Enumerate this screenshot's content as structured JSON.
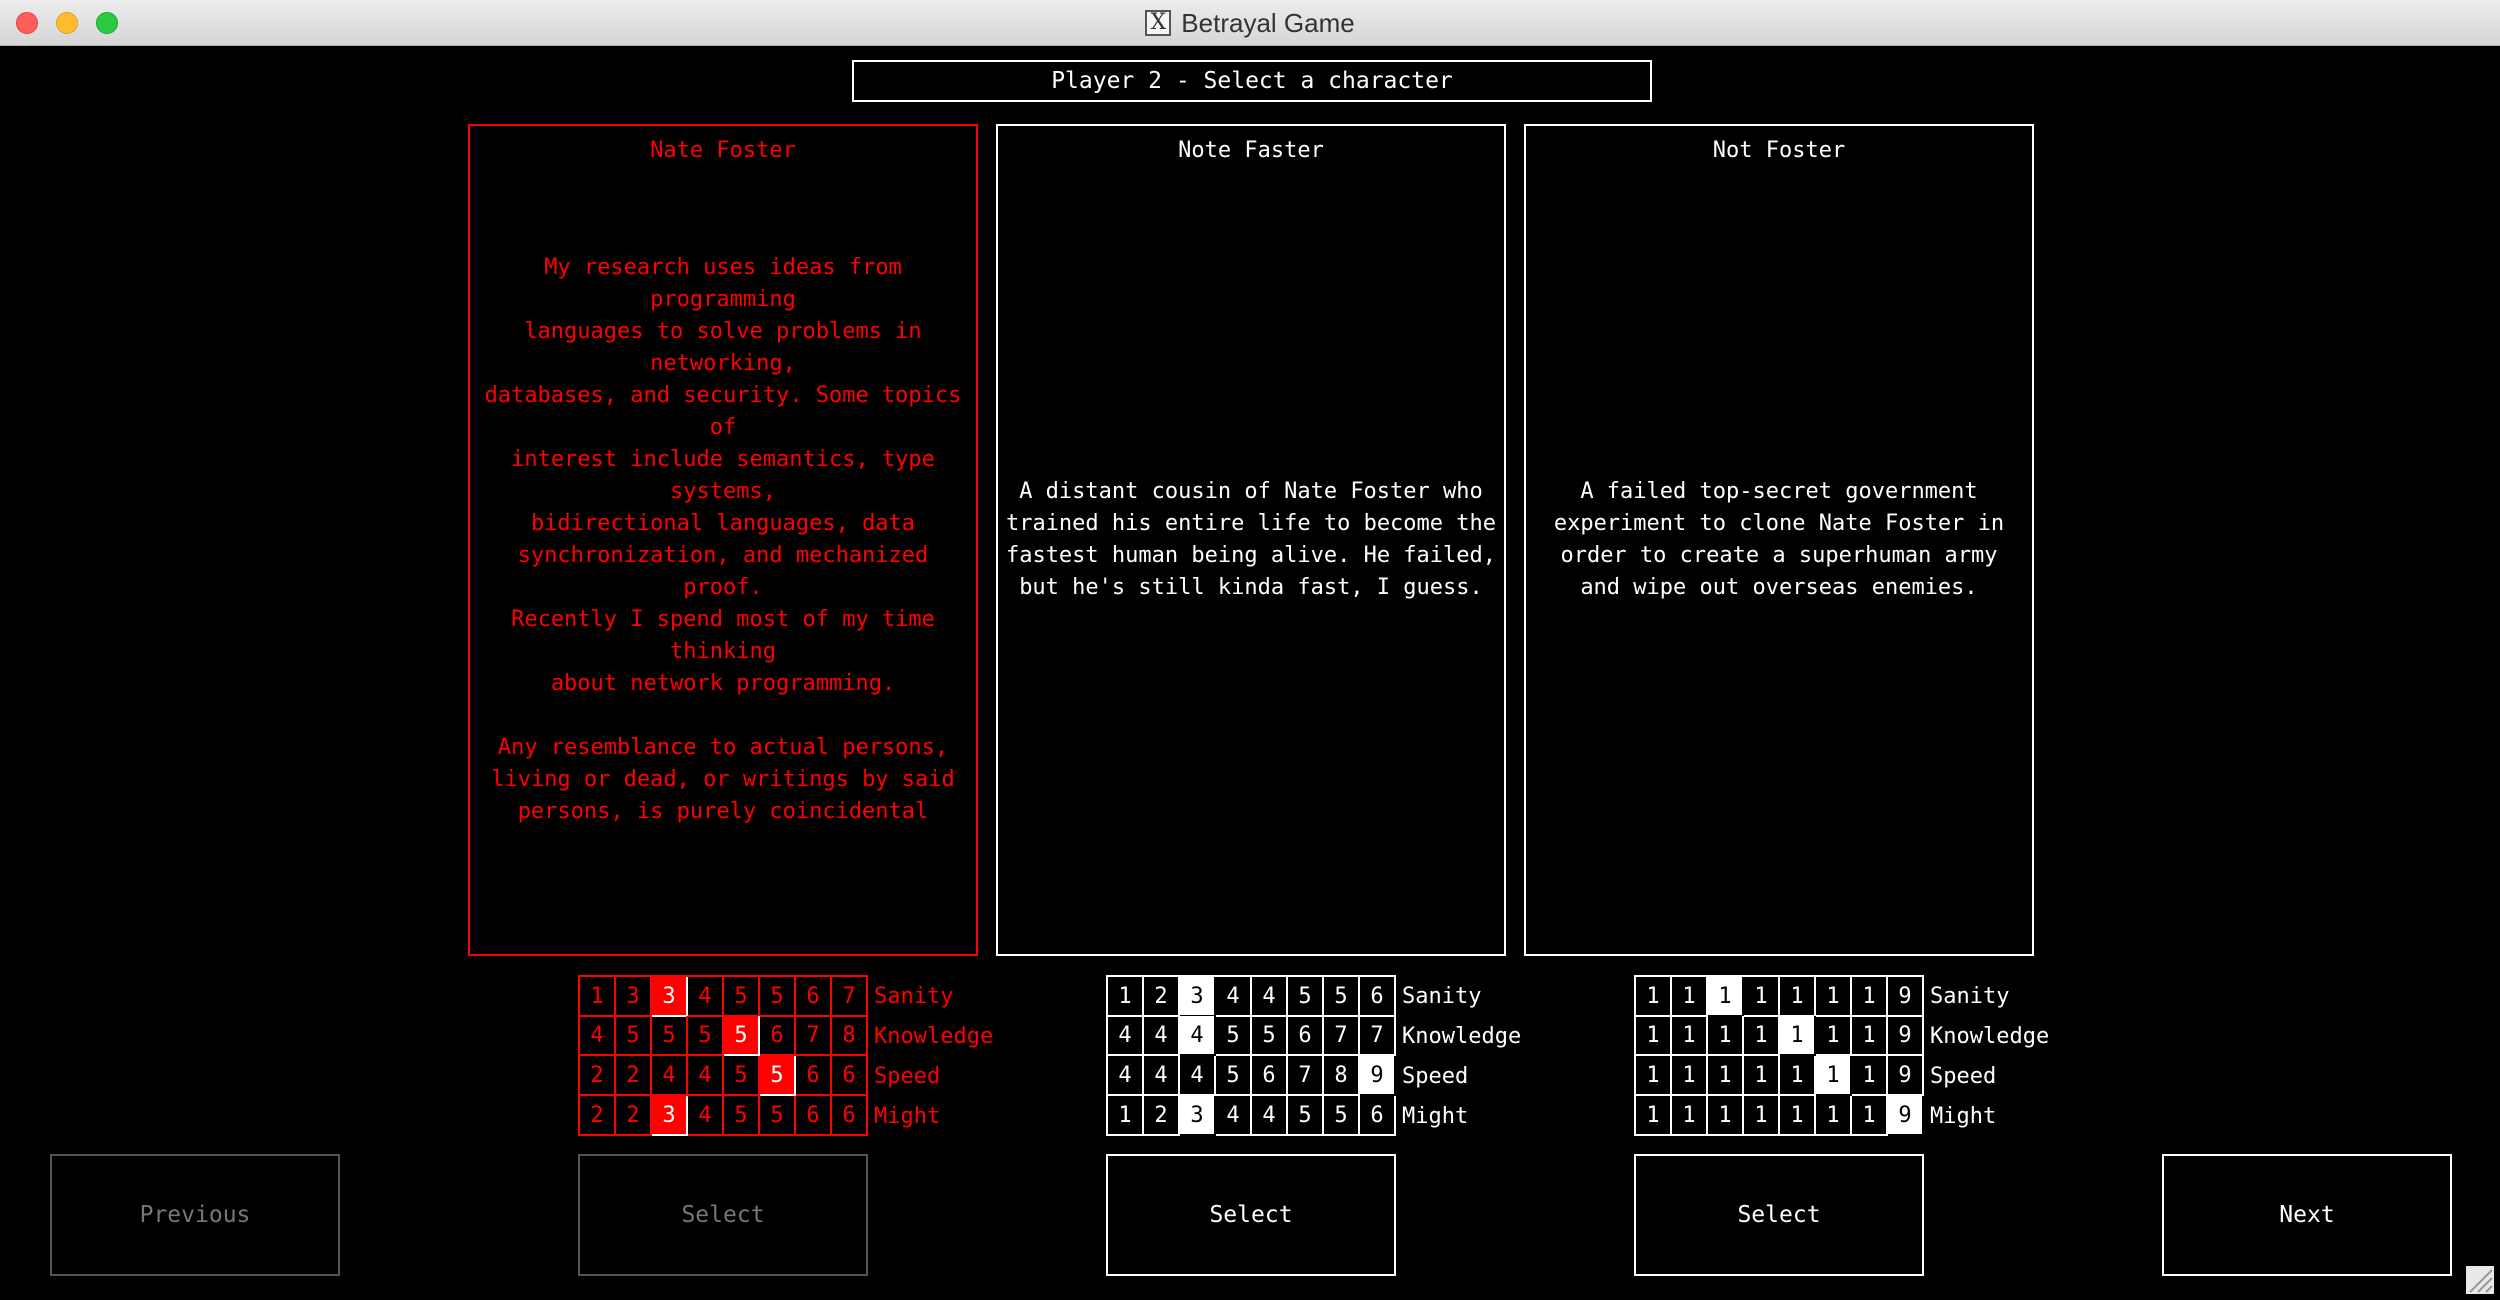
{
  "window": {
    "title": "Betrayal Game",
    "icon": "x11-icon"
  },
  "header": "Player 2 - Select a character",
  "characters": [
    {
      "name": "Nate Foster",
      "selected": true,
      "description": "My research uses ideas from programming\nlanguages to solve problems in networking,\ndatabases, and security. Some topics of\ninterest include semantics, type systems,\nbidirectional languages, data\nsynchronization, and mechanized proof.\nRecently I spend most of my time thinking\nabout network programming.\n\nAny resemblance to actual persons,\nliving or dead, or writings by said\npersons, is purely coincidental",
      "stats": [
        {
          "label": "Sanity",
          "values": [
            "1",
            "3",
            "3",
            "4",
            "5",
            "5",
            "6",
            "7"
          ],
          "current": 2
        },
        {
          "label": "Knowledge",
          "values": [
            "4",
            "5",
            "5",
            "5",
            "5",
            "6",
            "7",
            "8"
          ],
          "current": 4
        },
        {
          "label": "Speed",
          "values": [
            "2",
            "2",
            "4",
            "4",
            "5",
            "5",
            "6",
            "6"
          ],
          "current": 5
        },
        {
          "label": "Might",
          "values": [
            "2",
            "2",
            "3",
            "4",
            "5",
            "5",
            "6",
            "6"
          ],
          "current": 2
        }
      ],
      "select_label": "Select",
      "select_enabled": false
    },
    {
      "name": "Note Faster",
      "selected": false,
      "description": "A distant cousin of Nate Foster who\ntrained his entire life to become the\nfastest human being alive. He failed,\nbut he's still kinda fast, I guess.",
      "stats": [
        {
          "label": "Sanity",
          "values": [
            "1",
            "2",
            "3",
            "4",
            "4",
            "5",
            "5",
            "6"
          ],
          "current": 2
        },
        {
          "label": "Knowledge",
          "values": [
            "4",
            "4",
            "4",
            "5",
            "5",
            "6",
            "7",
            "7"
          ],
          "current": 2
        },
        {
          "label": "Speed",
          "values": [
            "4",
            "4",
            "4",
            "5",
            "6",
            "7",
            "8",
            "9"
          ],
          "current": 7
        },
        {
          "label": "Might",
          "values": [
            "1",
            "2",
            "3",
            "4",
            "4",
            "5",
            "5",
            "6"
          ],
          "current": 2
        }
      ],
      "select_label": "Select",
      "select_enabled": true
    },
    {
      "name": "Not Foster",
      "selected": false,
      "description": "A failed top-secret government\nexperiment to clone Nate Foster in\norder to create a superhuman army\nand wipe out overseas enemies.",
      "stats": [
        {
          "label": "Sanity",
          "values": [
            "1",
            "1",
            "1",
            "1",
            "1",
            "1",
            "1",
            "9"
          ],
          "current": 2
        },
        {
          "label": "Knowledge",
          "values": [
            "1",
            "1",
            "1",
            "1",
            "1",
            "1",
            "1",
            "9"
          ],
          "current": 4
        },
        {
          "label": "Speed",
          "values": [
            "1",
            "1",
            "1",
            "1",
            "1",
            "1",
            "1",
            "9"
          ],
          "current": 5
        },
        {
          "label": "Might",
          "values": [
            "1",
            "1",
            "1",
            "1",
            "1",
            "1",
            "1",
            "9"
          ],
          "current": 7
        }
      ],
      "select_label": "Select",
      "select_enabled": true
    }
  ],
  "nav": {
    "previous_label": "Previous",
    "previous_enabled": false,
    "next_label": "Next",
    "next_enabled": true
  },
  "colors": {
    "selected": "#ff0000",
    "normal": "#ffffff",
    "background": "#000000",
    "disabled": "#777777"
  }
}
